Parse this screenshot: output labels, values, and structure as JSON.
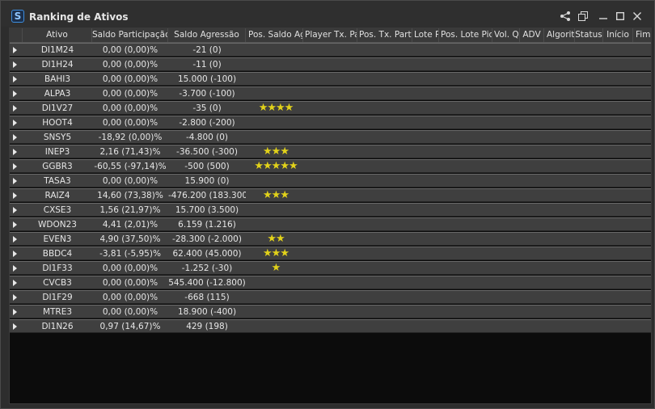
{
  "window": {
    "title": "Ranking de Ativos",
    "app_icon_letter": "S"
  },
  "columns": [
    "Ativo",
    "Saldo Participação",
    "Saldo Agressão",
    "Pos. Saldo Ag",
    "Player Tx. Pa",
    "Pos. Tx. Parti",
    "Lote Pi",
    "Pos. Lote Pior",
    "Vol. Qu",
    "ADV",
    "Algoriti",
    "Status",
    "Início",
    "Fim"
  ],
  "rows": [
    {
      "ativo": "DI1M24",
      "saldo_participacao": "0,00 (0,00)%",
      "saldo_agressao": "-21 (0)",
      "stars": ""
    },
    {
      "ativo": "DI1H24",
      "saldo_participacao": "0,00 (0,00)%",
      "saldo_agressao": "-11 (0)",
      "stars": ""
    },
    {
      "ativo": "BAHI3",
      "saldo_participacao": "0,00 (0,00)%",
      "saldo_agressao": "15.000 (-100)",
      "stars": ""
    },
    {
      "ativo": "ALPA3",
      "saldo_participacao": "0,00 (0,00)%",
      "saldo_agressao": "-3.700 (-100)",
      "stars": ""
    },
    {
      "ativo": "DI1V27",
      "saldo_participacao": "0,00 (0,00)%",
      "saldo_agressao": "-35 (0)",
      "stars": "★★★★"
    },
    {
      "ativo": "HOOT4",
      "saldo_participacao": "0,00 (0,00)%",
      "saldo_agressao": "-2.800 (-200)",
      "stars": ""
    },
    {
      "ativo": "SNSY5",
      "saldo_participacao": "-18,92 (0,00)%",
      "saldo_agressao": "-4.800 (0)",
      "stars": ""
    },
    {
      "ativo": "INEP3",
      "saldo_participacao": "2,16 (71,43)%",
      "saldo_agressao": "-36.500 (-300)",
      "stars": "★★★"
    },
    {
      "ativo": "GGBR3",
      "saldo_participacao": "-60,55 (-97,14)%",
      "saldo_agressao": "-500 (500)",
      "stars": "★★★★★"
    },
    {
      "ativo": "TASA3",
      "saldo_participacao": "0,00 (0,00)%",
      "saldo_agressao": "15.900 (0)",
      "stars": ""
    },
    {
      "ativo": "RAIZ4",
      "saldo_participacao": "14,60 (73,38)%",
      "saldo_agressao": "-476.200 (183.300)",
      "stars": "★★★"
    },
    {
      "ativo": "CXSE3",
      "saldo_participacao": "1,56 (21,97)%",
      "saldo_agressao": "15.700 (3.500)",
      "stars": ""
    },
    {
      "ativo": "WDON23",
      "saldo_participacao": "4,41 (2,01)%",
      "saldo_agressao": "6.159 (1.216)",
      "stars": ""
    },
    {
      "ativo": "EVEN3",
      "saldo_participacao": "4,90 (37,50)%",
      "saldo_agressao": "-28.300 (-2.000)",
      "stars": "★★"
    },
    {
      "ativo": "BBDC4",
      "saldo_participacao": "-3,81 (-5,95)%",
      "saldo_agressao": "62.400 (45.000)",
      "stars": "★★★"
    },
    {
      "ativo": "DI1F33",
      "saldo_participacao": "0,00 (0,00)%",
      "saldo_agressao": "-1.252 (-30)",
      "stars": "★"
    },
    {
      "ativo": "CVCB3",
      "saldo_participacao": "0,00 (0,00)%",
      "saldo_agressao": "545.400 (-12.800)",
      "stars": ""
    },
    {
      "ativo": "DI1F29",
      "saldo_participacao": "0,00 (0,00)%",
      "saldo_agressao": "-668 (115)",
      "stars": ""
    },
    {
      "ativo": "MTRE3",
      "saldo_participacao": "0,00 (0,00)%",
      "saldo_agressao": "18.900 (-400)",
      "stars": ""
    },
    {
      "ativo": "DI1N26",
      "saldo_participacao": "0,97 (14,67)%",
      "saldo_agressao": "429 (198)",
      "stars": ""
    }
  ],
  "colors": {
    "background": "#2d2d2d",
    "row": "#3f3f3f",
    "star": "#e2d21a",
    "empty_area": "#0c0c0c"
  },
  "icons": {
    "share": "share-icon",
    "popout": "popout-icon",
    "minimize": "minimize-icon",
    "maximize": "maximize-icon",
    "close": "close-icon"
  }
}
